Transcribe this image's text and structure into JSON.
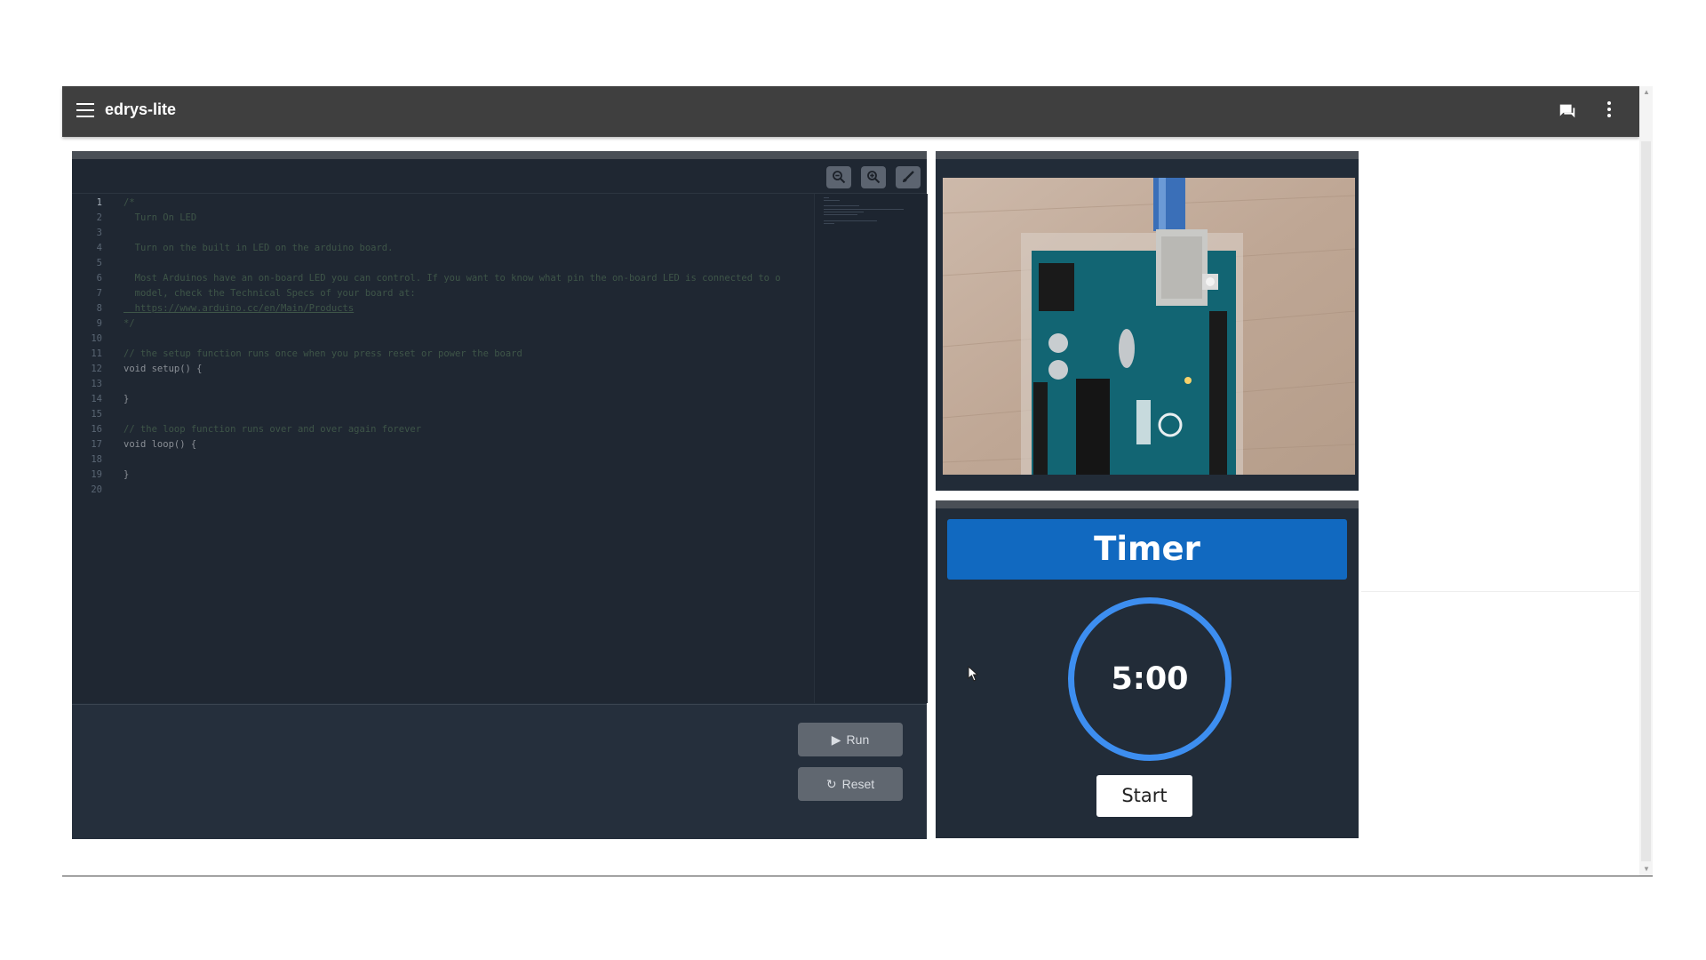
{
  "header": {
    "title": "edrys-lite",
    "icons": [
      "menu-icon",
      "chat-icon",
      "more-vert-icon"
    ]
  },
  "editor": {
    "toolbar_icons": [
      "zoom-out-icon",
      "zoom-in-icon",
      "brush-icon"
    ],
    "lines": [
      {
        "n": "1",
        "text": "/*"
      },
      {
        "n": "2",
        "text": "  Turn On LED"
      },
      {
        "n": "3",
        "text": ""
      },
      {
        "n": "4",
        "text": "  Turn on the built in LED on the arduino board."
      },
      {
        "n": "5",
        "text": ""
      },
      {
        "n": "6",
        "text": "  Most Arduinos have an on-board LED you can control. If you want to know what pin the on-board LED is connected to o"
      },
      {
        "n": "7",
        "text": "  model, check the Technical Specs of your board at:"
      },
      {
        "n": "8",
        "text": "  https://www.arduino.cc/en/Main/Products"
      },
      {
        "n": "9",
        "text": "*/"
      },
      {
        "n": "10",
        "text": ""
      },
      {
        "n": "11",
        "text": "// the setup function runs once when you press reset or power the board"
      },
      {
        "n": "12",
        "text": "void setup() {"
      },
      {
        "n": "13",
        "text": ""
      },
      {
        "n": "14",
        "text": "}"
      },
      {
        "n": "15",
        "text": ""
      },
      {
        "n": "16",
        "text": "// the loop function runs over and over again forever"
      },
      {
        "n": "17",
        "text": "void loop() {"
      },
      {
        "n": "18",
        "text": ""
      },
      {
        "n": "19",
        "text": "}"
      },
      {
        "n": "20",
        "text": ""
      }
    ],
    "run_label": "Run",
    "reset_label": "Reset"
  },
  "timer": {
    "title": "Timer",
    "value": "5:00",
    "start_label": "Start"
  },
  "colors": {
    "topbar": "#3f3f3f",
    "panel": "#222c38",
    "timer_header": "#1169c0",
    "timer_ring": "#3d8ef0"
  }
}
